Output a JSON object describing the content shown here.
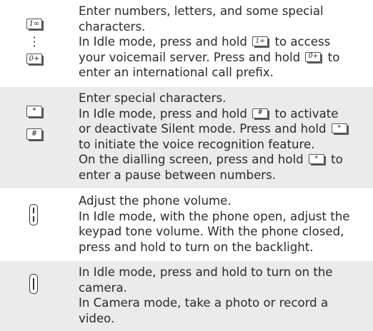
{
  "rows": [
    {
      "icon_keys": [
        "1∞",
        "0+"
      ],
      "lines": [
        [
          "Enter numbers, letters, and some special"
        ],
        [
          "characters."
        ],
        [
          "In Idle mode, press and hold ",
          "1∞",
          " to access"
        ],
        [
          "your voicemail server. Press and hold ",
          "0+",
          " to"
        ],
        [
          "enter an international call prefix."
        ]
      ]
    },
    {
      "icon_keys": [
        "*",
        "#"
      ],
      "lines": [
        [
          "Enter special characters."
        ],
        [
          "In Idle mode, press and hold ",
          "#",
          " to activate"
        ],
        [
          "or deactivate Silent mode. Press and hold ",
          "*"
        ],
        [
          "to initiate the voice recognition feature."
        ],
        [
          "On the dialling screen, press and hold ",
          "*",
          " to"
        ],
        [
          "enter a pause between numbers."
        ]
      ]
    },
    {
      "icon": "volume-side-key-icon",
      "lines": [
        [
          "Adjust the phone volume."
        ],
        [
          "In Idle mode, with the phone open, adjust the"
        ],
        [
          "keypad tone volume. With the phone closed,"
        ],
        [
          "press and hold to turn on the backlight."
        ]
      ]
    },
    {
      "icon": "camera-side-key-icon",
      "lines": [
        [
          "In Idle mode, press and hold to turn on the"
        ],
        [
          "camera."
        ],
        [
          "In Camera mode, take a photo or record a"
        ],
        [
          "video."
        ]
      ]
    }
  ],
  "text": {
    "r0l0": "Enter numbers, letters, and some special",
    "r0l1": "characters.",
    "r0l2a": "In Idle mode, press and hold ",
    "r0l2b": " to access",
    "r0l3a": "your voicemail server. Press and hold ",
    "r0l3b": " to",
    "r0l4": "enter an international call prefix.",
    "r1l0": "Enter special characters.",
    "r1l1a": "In Idle mode, press and hold ",
    "r1l1b": " to activate",
    "r1l2a": "or deactivate Silent mode. Press and hold ",
    "r1l3": "to initiate the voice recognition feature.",
    "r1l4a": "On the dialling screen, press and hold ",
    "r1l4b": " to",
    "r1l5": "enter a pause between numbers.",
    "r2l0": "Adjust the phone volume.",
    "r2l1": "In Idle mode, with the phone open, adjust the",
    "r2l2": "keypad tone volume. With the phone closed,",
    "r2l3": "press and hold to turn on the backlight.",
    "r3l0": "In Idle mode, press and hold to turn on the",
    "r3l1": "camera.",
    "r3l2": "In Camera mode, take a photo or record a",
    "r3l3": "video."
  },
  "keys": {
    "one": "1∞",
    "zero": "0+",
    "star": "*",
    "hash": "#"
  },
  "colors": {
    "row_band": "#ebebeb",
    "text": "#2a2a2a"
  }
}
